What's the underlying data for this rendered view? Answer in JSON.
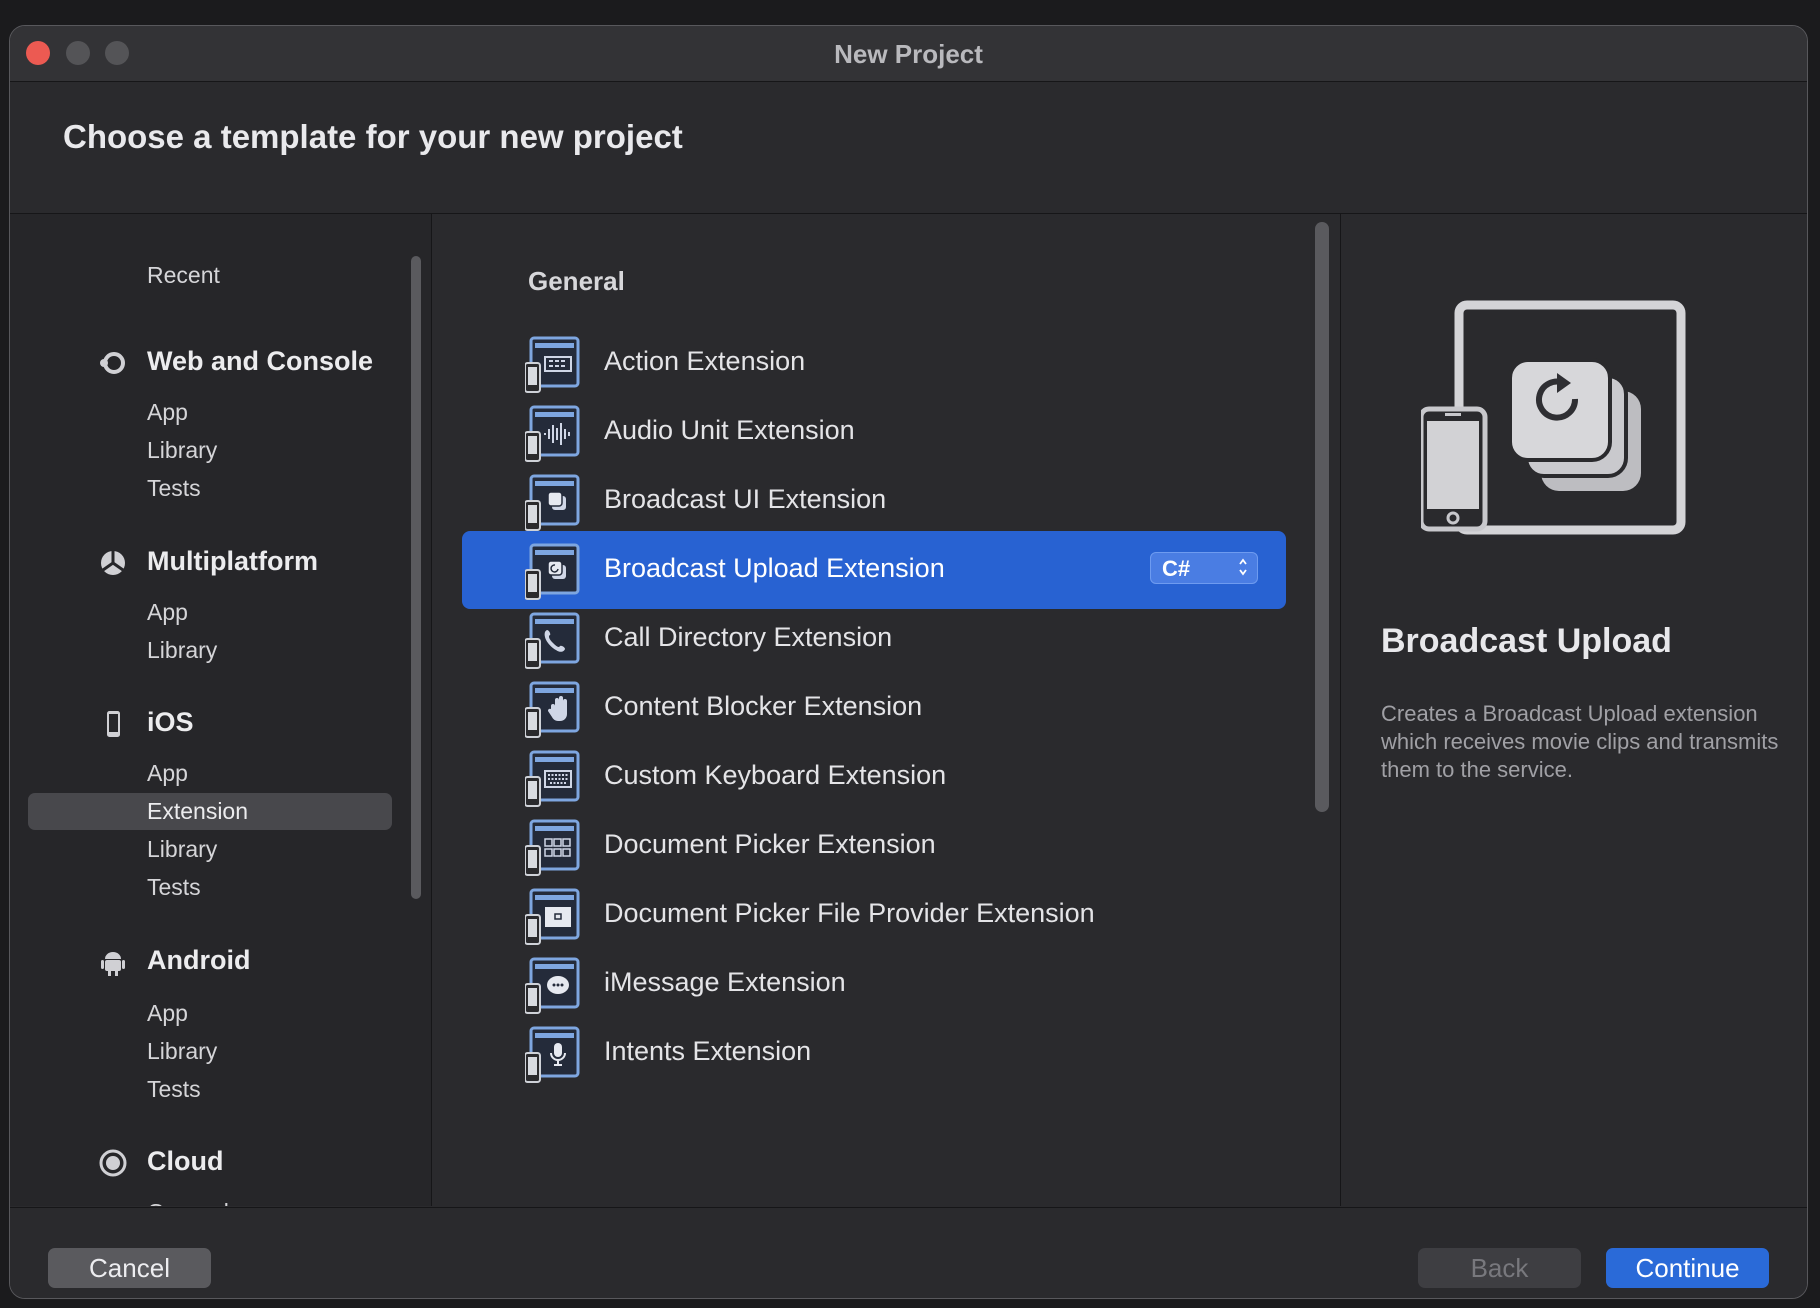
{
  "window": {
    "title": "New Project"
  },
  "header": {
    "title": "Choose a template for your new project"
  },
  "sidebar": {
    "recent": "Recent",
    "categories": [
      {
        "label": "Web and Console",
        "icon": "web-console-icon",
        "items": [
          "App",
          "Library",
          "Tests"
        ]
      },
      {
        "label": "Multiplatform",
        "icon": "multiplatform-icon",
        "items": [
          "App",
          "Library"
        ]
      },
      {
        "label": "iOS",
        "icon": "iphone-icon",
        "items": [
          "App",
          "Extension",
          "Library",
          "Tests"
        ]
      },
      {
        "label": "Android",
        "icon": "android-icon",
        "items": [
          "App",
          "Library",
          "Tests"
        ]
      },
      {
        "label": "Cloud",
        "icon": "cloud-icon",
        "items": [
          "General"
        ]
      }
    ],
    "selected": "Extension"
  },
  "templates": {
    "section": "General",
    "items": [
      {
        "label": "Action Extension",
        "icon": "action-extension-icon"
      },
      {
        "label": "Audio Unit Extension",
        "icon": "audio-unit-extension-icon"
      },
      {
        "label": "Broadcast UI Extension",
        "icon": "broadcast-ui-extension-icon"
      },
      {
        "label": "Broadcast Upload Extension",
        "icon": "broadcast-upload-extension-icon"
      },
      {
        "label": "Call Directory Extension",
        "icon": "call-directory-extension-icon"
      },
      {
        "label": "Content Blocker Extension",
        "icon": "content-blocker-extension-icon"
      },
      {
        "label": "Custom Keyboard Extension",
        "icon": "custom-keyboard-extension-icon"
      },
      {
        "label": "Document Picker Extension",
        "icon": "document-picker-extension-icon"
      },
      {
        "label": "Document Picker File Provider Extension",
        "icon": "document-picker-file-provider-extension-icon"
      },
      {
        "label": "iMessage Extension",
        "icon": "imessage-extension-icon"
      },
      {
        "label": "Intents Extension",
        "icon": "intents-extension-icon"
      }
    ],
    "selected": "Broadcast Upload Extension",
    "language": {
      "value": "C#"
    }
  },
  "preview": {
    "title": "Broadcast Upload",
    "description": "Creates a Broadcast Upload extension which receives movie clips and transmits them to the service."
  },
  "footer": {
    "cancel": "Cancel",
    "back": "Back",
    "continue": "Continue"
  },
  "colors": {
    "accent": "#2862d2",
    "close": "#ec5a52"
  }
}
